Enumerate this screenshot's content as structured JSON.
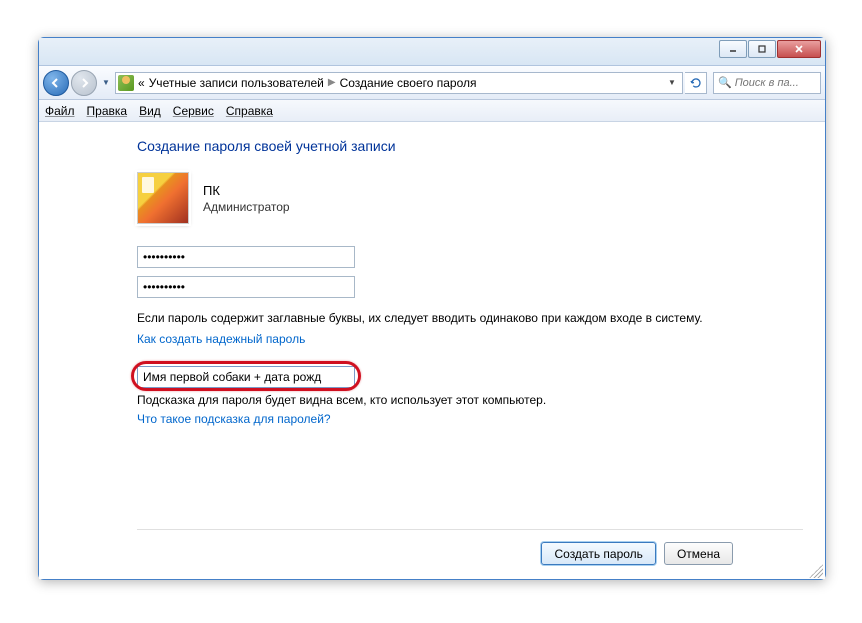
{
  "breadcrumb": {
    "prefix": "«",
    "part1": "Учетные записи пользователей",
    "part2": "Создание своего пароля"
  },
  "search": {
    "placeholder": "Поиск в па..."
  },
  "menu": {
    "file": "Файл",
    "edit": "Правка",
    "view": "Вид",
    "tools": "Сервис",
    "help": "Справка"
  },
  "heading": "Создание пароля своей учетной записи",
  "user": {
    "name": "ПК",
    "role": "Администратор"
  },
  "fields": {
    "password1_value": "••••••••••",
    "password2_value": "••••••••••",
    "hint_value": "Имя первой собаки + дата рожд"
  },
  "text": {
    "caps_note": "Если пароль содержит заглавные буквы, их следует вводить одинаково при каждом входе в систему.",
    "strong_link": "Как создать надежный пароль",
    "hint_note": "Подсказка для пароля будет видна всем, кто использует этот компьютер.",
    "hint_link": "Что такое подсказка для паролей?"
  },
  "buttons": {
    "create": "Создать пароль",
    "cancel": "Отмена"
  }
}
